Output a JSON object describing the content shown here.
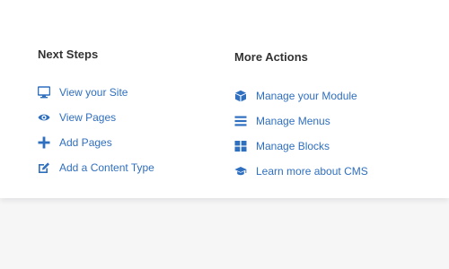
{
  "theme": {
    "link_color": "#2f6fbf",
    "heading_color": "#333333",
    "card_bg": "#ffffff",
    "page_bg": "#f6f6f7"
  },
  "next_steps": {
    "title": "Next Steps",
    "items": [
      {
        "label": "View your Site",
        "icon": "monitor-icon"
      },
      {
        "label": "View Pages",
        "icon": "eye-icon"
      },
      {
        "label": "Add Pages",
        "icon": "plus-icon"
      },
      {
        "label": "Add a Content Type",
        "icon": "edit-icon"
      }
    ]
  },
  "more_actions": {
    "title": "More Actions",
    "items": [
      {
        "label": "Manage your Module",
        "icon": "cube-icon"
      },
      {
        "label": "Manage Menus",
        "icon": "bars-icon"
      },
      {
        "label": "Manage Blocks",
        "icon": "blocks-grid-icon"
      },
      {
        "label": "Learn more about CMS",
        "icon": "graduation-cap-icon"
      }
    ]
  }
}
